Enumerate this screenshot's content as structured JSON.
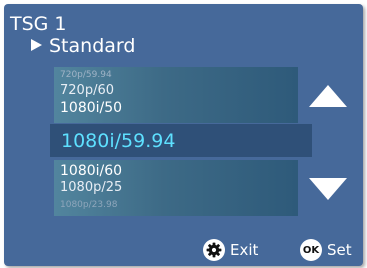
{
  "header": {
    "title": "TSG 1",
    "subtitle": "Standard"
  },
  "options": {
    "above": [
      "720p/59.94",
      "720p/60",
      "1080i/50"
    ],
    "selected": "1080i/59.94",
    "below": [
      "1080i/60",
      "1080p/25",
      "1080p/23.98"
    ]
  },
  "footer": {
    "exit_label": "Exit",
    "set_label": "Set",
    "ok_glyph": "OK"
  },
  "icons": {
    "exit": "gear-icon",
    "set": "ok-icon",
    "scroll_up": "triangle-up-icon",
    "scroll_down": "triangle-down-icon",
    "submenu": "triangle-right-icon"
  },
  "colors": {
    "background": "#46699a",
    "selected_text": "#5ee0ff",
    "selected_band": "#2f5078"
  }
}
